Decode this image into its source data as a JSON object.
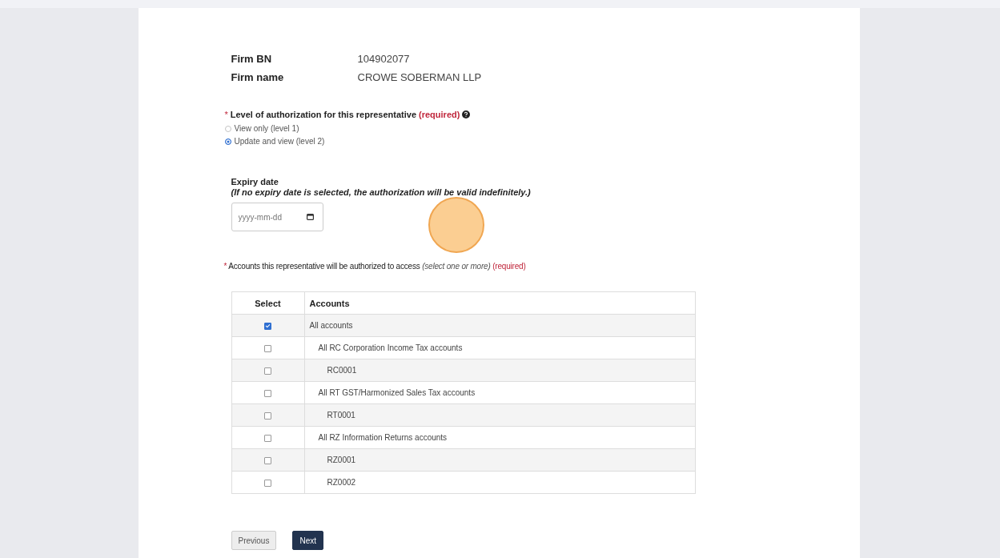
{
  "firm": [
    {
      "label": "Firm BN",
      "value": "104902077"
    },
    {
      "label": "Firm name",
      "value": "CROWE SOBERMAN LLP"
    }
  ],
  "authorization": {
    "required_mark": "*",
    "label": "Level of authorization for this representative",
    "required": "(required)",
    "options": [
      {
        "label": "View only (level 1)",
        "selected": false
      },
      {
        "label": "Update and view (level 2)",
        "selected": true
      }
    ]
  },
  "expiry": {
    "label": "Expiry date",
    "note": "(If no expiry date is selected, the authorization will be valid indefinitely.)",
    "placeholder": "yyyy-mm-dd"
  },
  "accounts": {
    "required_mark": "*",
    "label": "Accounts this representative will be authorized to access",
    "hint": "(select one or more)",
    "required": "(required)",
    "columns": [
      "Select",
      "Accounts"
    ],
    "rows": [
      {
        "label": "All accounts",
        "checked": true,
        "children": [
          {
            "label": "All RC Corporation Income Tax accounts",
            "checked": false,
            "children": [
              {
                "label": "RC0001",
                "checked": false
              }
            ]
          },
          {
            "label": "All RT GST/Harmonized Sales Tax accounts",
            "checked": false,
            "children": [
              {
                "label": "RT0001",
                "checked": false
              }
            ]
          },
          {
            "label": "All RZ Information Returns accounts",
            "checked": false,
            "children": [
              {
                "label": "RZ0001",
                "checked": false
              },
              {
                "label": "RZ0002",
                "checked": false
              }
            ]
          }
        ]
      }
    ]
  },
  "buttons": [
    {
      "label": "Previous",
      "kind": "secondary"
    },
    {
      "label": "Next",
      "kind": "primary"
    }
  ]
}
